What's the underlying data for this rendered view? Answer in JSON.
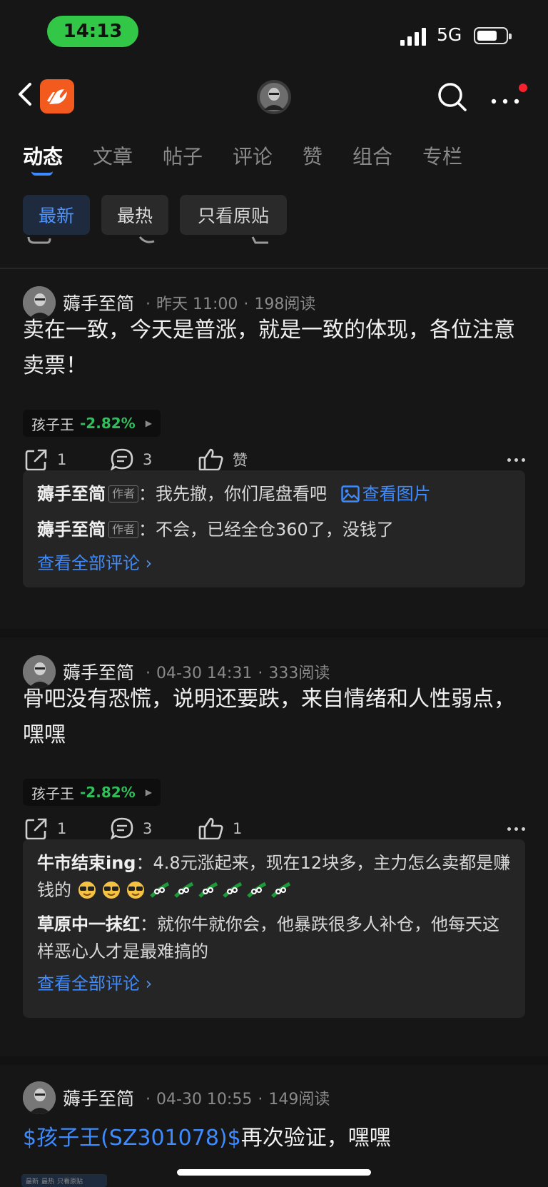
{
  "status_bar": {
    "time": "14:13",
    "network": "5G"
  },
  "nav": {
    "logo_name": "east-money-logo"
  },
  "tabs": [
    {
      "label": "动态"
    },
    {
      "label": "文章"
    },
    {
      "label": "帖子"
    },
    {
      "label": "评论"
    },
    {
      "label": "赞"
    },
    {
      "label": "组合"
    },
    {
      "label": "专栏"
    }
  ],
  "filters": [
    {
      "label": "最新"
    },
    {
      "label": "最热"
    },
    {
      "label": "只看原贴"
    }
  ],
  "posts": [
    {
      "author": "薅手至简",
      "time": "昨天 11:00",
      "reads": "198阅读",
      "text": "卖在一致，今天是普涨，就是一致的体现，各位注意卖票！",
      "stock": {
        "name": "孩子王",
        "change": "-2.82%"
      },
      "shares": "1",
      "comments": "3",
      "likes": "赞",
      "replies": [
        {
          "user": "薅手至简",
          "badge": "作者",
          "text": "我先撤，你们尾盘看吧",
          "link": "查看图片"
        },
        {
          "user": "薅手至简",
          "badge": "作者",
          "text": "不会，已经全仓360了，没钱了"
        }
      ],
      "view_all": "查看全部评论"
    },
    {
      "author": "薅手至简",
      "time": "04-30 14:31",
      "reads": "333阅读",
      "text": "骨吧没有恐慌，说明还要跌，来自情绪和人性弱点，嘿嘿",
      "stock": {
        "name": "孩子王",
        "change": "-2.82%"
      },
      "shares": "1",
      "comments": "3",
      "likes": "1",
      "replies": [
        {
          "user": "牛市结束ing",
          "text": "4.8元涨起来，现在12块多，主力怎么卖都是赚钱的"
        },
        {
          "user": "草原中一抹红",
          "text": "就你牛就你会，他暴跌很多人补仓，他每天这样恶心人才是最难搞的"
        }
      ],
      "view_all": "查看全部评论"
    },
    {
      "author": "薅手至简",
      "time": "04-30 10:55",
      "reads": "149阅读",
      "text_link": "$孩子王(SZ301078)$",
      "text_rest": "再次验证，嘿嘿"
    }
  ],
  "thumb": {
    "labels": [
      "最新",
      "最热",
      "只看原贴"
    ]
  },
  "colors": {
    "accent": "#3d8bff",
    "down_green": "#2fbf5a",
    "time_pill": "#33c748"
  }
}
